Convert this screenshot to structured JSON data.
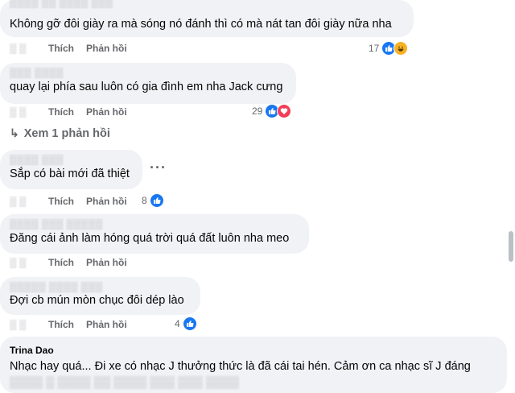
{
  "accent_like": "#1877f2",
  "action_labels": {
    "like": "Thích",
    "reply": "Phản hồi"
  },
  "comments": [
    {
      "author": "",
      "text": "Không gỡ đôi giày ra mà sóng nó đánh thì có mà nát tan đôi giày nữa nha",
      "reaction_count": "17",
      "reactions": [
        "like-icon",
        "haha-icon"
      ]
    },
    {
      "author": "",
      "text": "quay lại phía sau luôn có gia đình em nha Jack cưng",
      "reaction_count": "29",
      "reactions": [
        "like-icon",
        "love-icon"
      ]
    },
    {
      "author": "",
      "text": "Sắp có bài mới đã thiệt",
      "reaction_count": "8",
      "reactions": [
        "like-icon"
      ]
    },
    {
      "author": "",
      "text": "Đăng cái ảnh làm hóng quá trời quá đất luôn nha meo",
      "reaction_count": "",
      "reactions": []
    },
    {
      "author": "",
      "text": "Đợi cb mún mòn chục đôi dép lào",
      "reaction_count": "4",
      "reactions": [
        "like-icon"
      ]
    },
    {
      "author": "Trina Dao",
      "text": "Nhạc hay quá... Đi xe có nhạc J thưởng thức là đã cái tai hén. Cảm ơn ca nhạc sĩ J đáng",
      "text_line2": "",
      "reaction_count": "",
      "reactions": []
    }
  ],
  "view_replies": "Xem 1 phản hồi"
}
